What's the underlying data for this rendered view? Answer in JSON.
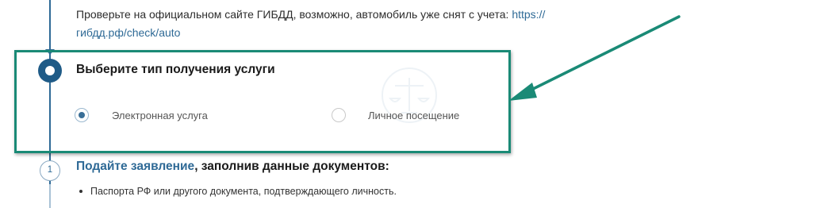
{
  "intro": {
    "text": "Проверьте на официальном сайте ГИБДД, возможно, автомобиль уже снят с учета: ",
    "link_part1": "https://",
    "link_part2": "гибдд.рф/check/auto"
  },
  "step_service": {
    "title": "Выберите тип получения услуги",
    "options": [
      {
        "label": "Электронная услуга",
        "selected": true
      },
      {
        "label": "Личное посещение",
        "selected": false
      }
    ]
  },
  "step_apply": {
    "number": "1",
    "title_link": "Подайте заявление",
    "title_rest": ", заполнив данные документов:",
    "bullets": [
      "Паспорта РФ или другого документа, подтверждающего личность."
    ]
  },
  "colors": {
    "accent": "#2f6a96",
    "highlight": "#1a8a76"
  },
  "icons": {
    "watermark": "emblem-icon",
    "callout": "arrow-icon"
  }
}
